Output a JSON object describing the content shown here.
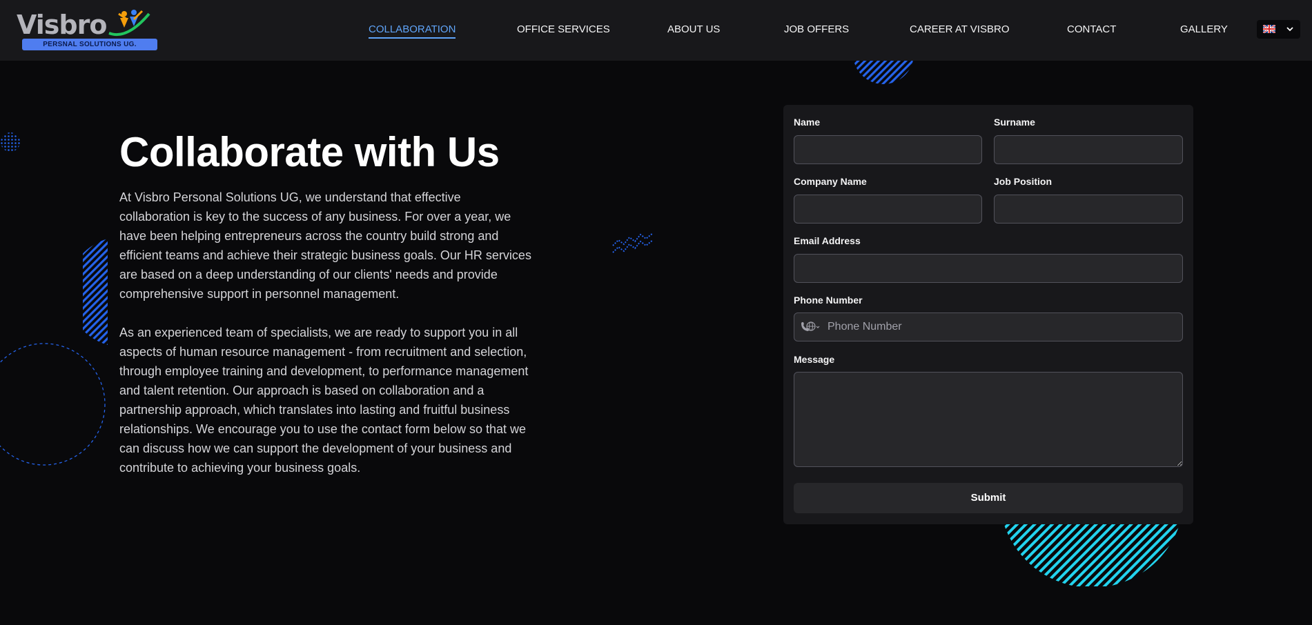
{
  "header": {
    "logo": {
      "word": "Visbro",
      "tagline": "PERSNAL SOLUTIONS UG."
    },
    "nav": [
      {
        "label": "COLLABORATION"
      },
      {
        "label": "OFFICE SERVICES"
      },
      {
        "label": "ABOUT US"
      },
      {
        "label": "JOB OFFERS"
      },
      {
        "label": "CAREER AT VISBRO"
      },
      {
        "label": "CONTACT"
      },
      {
        "label": "GALLERY"
      }
    ],
    "active_nav": "COLLABORATION",
    "language": {
      "flag": "uk-flag-icon",
      "chevron": "chevron-down-icon"
    }
  },
  "hero": {
    "title": "Collaborate with Us",
    "paragraph1": "At Visbro Personal Solutions UG, we understand that effective collaboration is key to the success of any business. For over a year, we have been helping entrepreneurs across the country build strong and efficient teams and achieve their strategic business goals. Our HR services are based on a deep understanding of our clients' needs and provide comprehensive support in personnel management.",
    "paragraph2": "As an experienced team of specialists, we are ready to support you in all aspects of human resource management - from recruitment and selection, through employee training and development, to performance management and talent retention. Our approach is based on collaboration and a partnership approach, which translates into lasting and fruitful business relationships. We encourage you to use the contact form below so that we can discuss how we can support the development of your business and contribute to achieving your business goals."
  },
  "form": {
    "name_label": "Name",
    "surname_label": "Surname",
    "company_label": "Company Name",
    "job_position_label": "Job Position",
    "email_label": "Email Address",
    "phone_label": "Phone Number",
    "phone_placeholder": "Phone Number",
    "message_label": "Message",
    "submit_label": "Submit"
  },
  "colors": {
    "accent": "#60a5fa",
    "decor_blue": "#2563eb",
    "decor_cyan": "#22d3ee",
    "panel": "#18181b",
    "background": "#09090b"
  }
}
